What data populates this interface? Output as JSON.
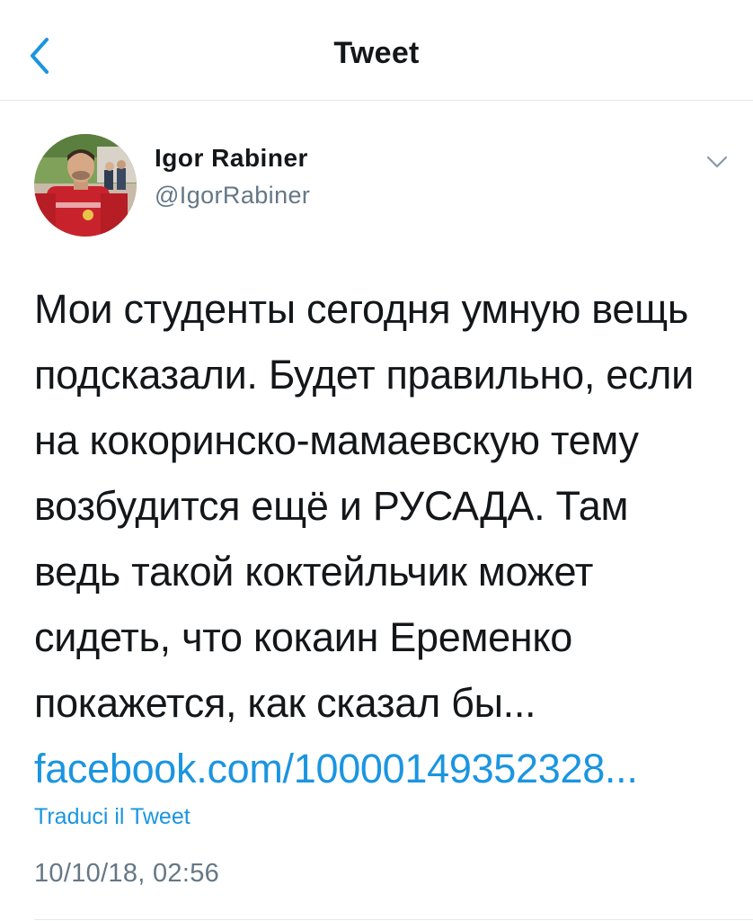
{
  "navbar": {
    "title": "Tweet",
    "back_icon": "chevron-left-icon"
  },
  "tweet": {
    "author": {
      "name": "Igor Rabiner",
      "handle": "@IgorRabiner",
      "avatar": "profile-photo"
    },
    "menu_icon": "chevron-down-icon",
    "text_lines": [
      "Мои студенты сегодня умную вещь",
      "подсказали. Будет правильно, если",
      "на кокоринско-мамаевскую тему",
      "возбудится ещё и РУСАДА. Там",
      "ведь такой коктейльчик может",
      "сидеть, что кокаин Еременко",
      "покажется, как сказал бы..."
    ],
    "link": "facebook.com/10000149352328...",
    "translate_label": "Traduci il Tweet",
    "timestamp": "10/10/18, 02:56"
  },
  "colors": {
    "accent": "#1b95e0",
    "text": "#14171a",
    "secondary": "#657786",
    "border": "#e1e8ed"
  }
}
